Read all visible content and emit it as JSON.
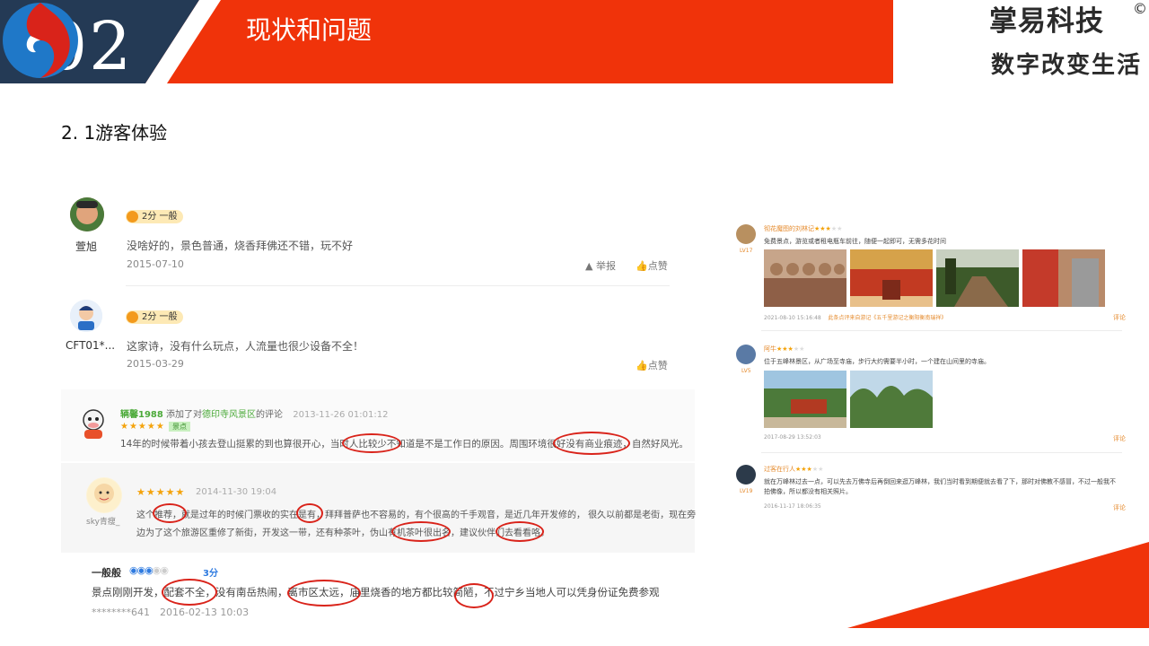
{
  "header": {
    "section_number": "02",
    "title": "现状和问题",
    "brand": "掌易科技",
    "brand_mark": "©",
    "slogan": "数字改变生活",
    "colors": {
      "navy": "#243a55",
      "red": "#f0330a"
    }
  },
  "section_title": "2. 1游客体验",
  "left_reviews": [
    {
      "user": "萱旭",
      "rating": "2分 一般",
      "text": "没啥好的，景色普通，烧香拜佛还不错，玩不好",
      "date": "2015-07-10",
      "report": "举报",
      "like": "点赞"
    },
    {
      "user": "CFT01*...",
      "rating": "2分 一般",
      "text": "这家诗，没有什么玩点，人流量也很少设备不全！",
      "date": "2015-03-29",
      "like": "点赞"
    }
  ],
  "review3": {
    "user": "辆馨1988",
    "action_prefix": "添加了对",
    "place": "德印寺风景区",
    "action_suffix": "的评论",
    "time": "2013-11-26 01:01:12",
    "stars": "★★★★★",
    "tag": "景点",
    "text": "14年的时候带着小孩去登山挺累的到也算很开心，当时人比较少不知道是不是工作日的原因。周围环境很好没有商业痕迹，自然好风光。"
  },
  "review4": {
    "user": "sky青瘦_",
    "stars": "★★★★★",
    "time": "2014-11-30 19:04",
    "line1": "这个推荐，就是过年的时候门票收的实在是有，拜拜普萨也不容易的，有个很高的千手观音，是近几年开发修的， 很久以前都是老街，现在旁",
    "line2": "边为了这个旅游区重修了新街，开发这一带，还有种茶叶，伪山有机茶叶很出名，建议伙伴们去看看咯。"
  },
  "review5": {
    "label": "一般般",
    "score": "3分",
    "text": "景点刚刚开发，配套不全，没有南岳热闹，离市区太远，庙里烧香的地方都比较简陋，不过宁乡当地人可以凭身份证免费参观",
    "user": "********641",
    "time": "2016-02-13 10:03"
  },
  "right_reviews": [
    {
      "name": "彻花魔图的刘林记",
      "stars": "★★★",
      "lv": "LV17",
      "text": "免费景点，游览或者租电瓶车前往，随便一起即可，无需多花时间",
      "meta": "2021-08-10 15:16:48",
      "from": "此条点评来自游记《五千里游记之衡阳衡南瑞祥》",
      "reply": "评论"
    },
    {
      "name": "阿牛",
      "stars": "★★★",
      "lv": "LV5",
      "text": "位于五峰林景区，从广场至寺庙，步行大约需要半小时，一个建在山间里的寺庙。",
      "meta": "2017-08-29 13:52:03",
      "reply": "评论"
    },
    {
      "name": "过客在行人",
      "stars": "★★★",
      "lv": "LV19",
      "text": "就在万峰林过去一点，可以先去万佛寺后再倒回来逛万峰林，我们当时看到期便就去看了下，那时对佛教不感冒，不过一般我不拍佛像，所以都没有相关照片。",
      "meta": "2016-11-17 18:06:35",
      "reply": "评论"
    }
  ]
}
